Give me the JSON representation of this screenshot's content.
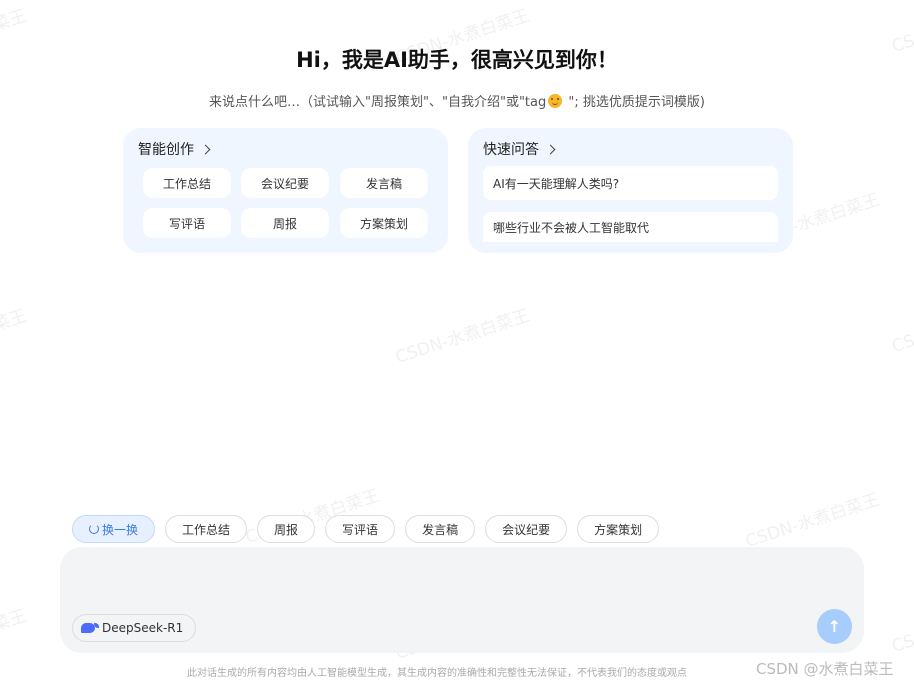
{
  "header": {
    "title": "Hi，我是AI助手，很高兴见到你！",
    "subtitle_before": "来说点什么吧…（试试输入\"周报策划\"、\"自我介绍\"或\"tag",
    "subtitle_after": " \"; 挑选优质提示词模版)"
  },
  "creation": {
    "title": "智能创作",
    "items": [
      "工作总结",
      "会议纪要",
      "发言稿",
      "写评语",
      "周报",
      "方案策划"
    ]
  },
  "qa": {
    "title": "快速问答",
    "items": [
      "AI有一天能理解人类吗?",
      "哪些行业不会被人工智能取代"
    ]
  },
  "suggestions": {
    "refresh_label": "换一换",
    "items": [
      "工作总结",
      "周报",
      "写评语",
      "发言稿",
      "会议纪要",
      "方案策划"
    ]
  },
  "composer": {
    "model_label": "DeepSeek-R1",
    "send_icon": "arrow-up-icon"
  },
  "footer": {
    "disclaimer": "此对话生成的所有内容均由人工智能模型生成，其生成内容的准确性和完整性无法保证，不代表我们的态度或观点",
    "brand": "CSDN @水煮白菜王"
  },
  "watermark": {
    "text": "CSDN-水煮白菜王",
    "short_left": "菜王",
    "short_right": "CS"
  }
}
